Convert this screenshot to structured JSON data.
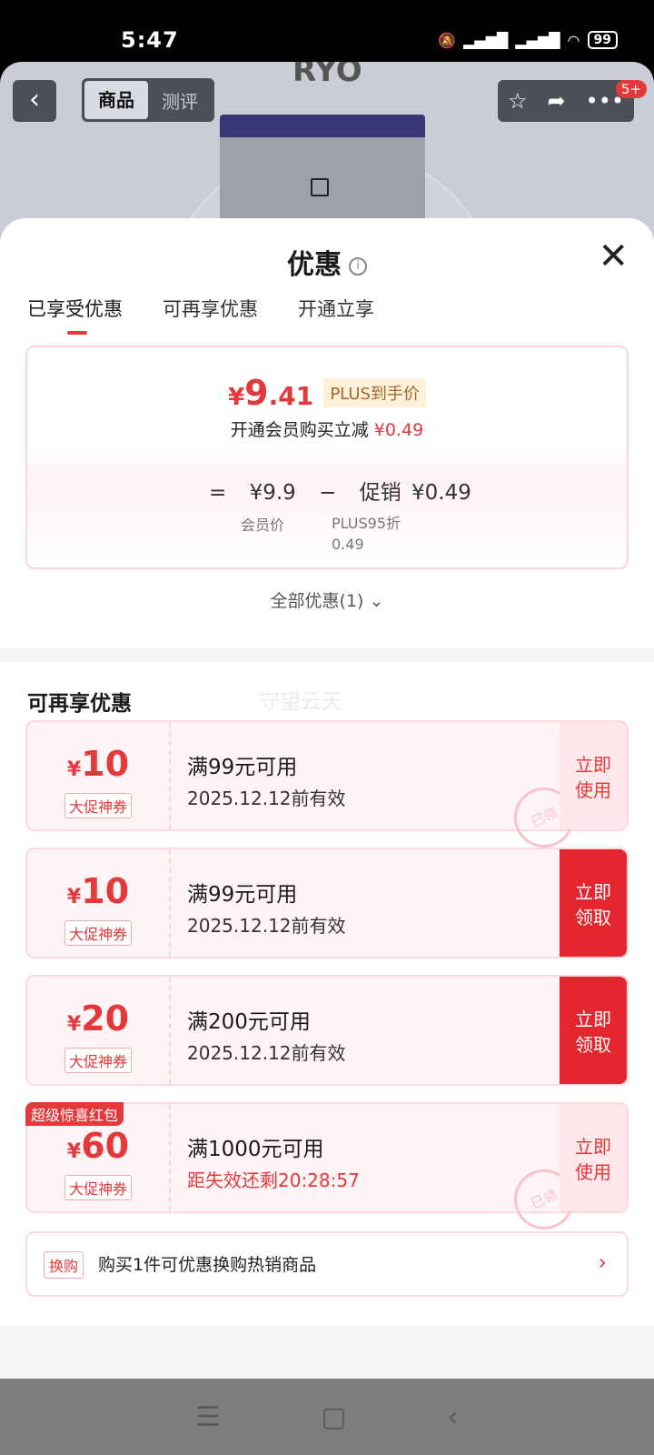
{
  "status": {
    "time": "5:47",
    "battery": "99"
  },
  "product": {
    "brand": "RYO",
    "tabs": [
      "商品",
      "测评"
    ],
    "cart_badge": "5+"
  },
  "sheet": {
    "title": "优惠",
    "tabs": [
      "已享受优惠",
      "可再享优惠",
      "开通立享"
    ],
    "price_integer": "9",
    "price_decimal": ".41",
    "currency": "¥",
    "plus_tag": "PLUS到手价",
    "member_line": "开通会员购买立减",
    "member_saving": "¥0.49",
    "equation": {
      "eq": "=",
      "member_price": "¥9.9",
      "minus": "−",
      "promo_label": "促销",
      "promo_value": "¥0.49"
    },
    "member_price_label": "会员价",
    "plus_discount_label": "PLUS95折",
    "plus_discount_value": "0.49",
    "all_offers": "全部优惠(1)"
  },
  "more": {
    "title": "可再享优惠",
    "watermark": "守望云天",
    "coupons": [
      {
        "amount": "10",
        "tag": "大促神券",
        "cond": "满99元可用",
        "valid": "2025.12.12前有效",
        "action": "立即使用",
        "stamp": "已领"
      },
      {
        "amount": "10",
        "tag": "大促神券",
        "cond": "满99元可用",
        "valid": "2025.12.12前有效",
        "action": "立即领取"
      },
      {
        "amount": "20",
        "tag": "大促神券",
        "cond": "满200元可用",
        "valid": "2025.12.12前有效",
        "action": "立即领取"
      },
      {
        "amount": "60",
        "tag": "大促神券",
        "cond": "满1000元可用",
        "valid": "距失效还剩20:28:57",
        "action": "立即使用",
        "ribbon": "超级惊喜红包",
        "stamp": "已领"
      }
    ],
    "swap": {
      "tag": "换购",
      "text": "购买1件可优惠换购热销商品"
    }
  }
}
